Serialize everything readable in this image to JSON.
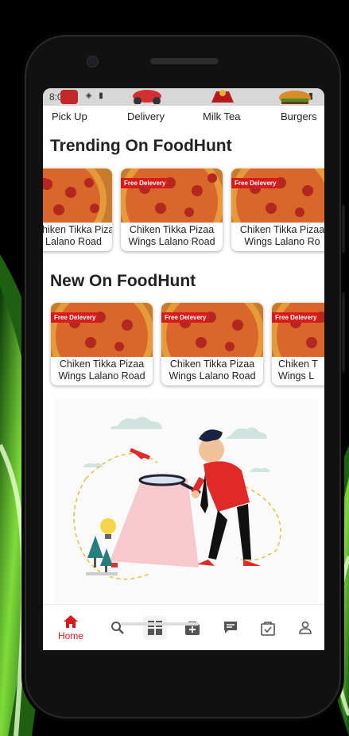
{
  "status_bar": {
    "time": "8:05"
  },
  "categories": [
    "Pick Up",
    "Delivery",
    "Milk Tea",
    "Burgers"
  ],
  "trending": {
    "title": "Trending On FoodHunt",
    "cards": [
      {
        "badge": "",
        "line1": "Chiken Tikka Pizaa",
        "line2": "Lalano Road"
      },
      {
        "badge": "Free Delevery",
        "line1": "Chiken Tikka Pizaa",
        "line2": "Wings Lalano Road"
      },
      {
        "badge": "Free Delevery",
        "line1": "Chiken Tikka Pizaa",
        "line2": "Wings Lalano Ro"
      }
    ]
  },
  "new": {
    "title": "New On FoodHunt",
    "cards": [
      {
        "badge": "Free Delevery",
        "line1": "Chiken Tikka Pizaa",
        "line2": "Wings  Lalano Road"
      },
      {
        "badge": "Free Delevery",
        "line1": "Chiken Tikka Pizaa",
        "line2": "Wings  Lalano Road"
      },
      {
        "badge": "Free Delevery",
        "line1": "Chiken T",
        "line2": "Wings  L"
      }
    ]
  },
  "bottom_nav": {
    "active_color": "#d71a1a",
    "items": [
      {
        "icon": "home-icon",
        "label": "Home"
      },
      {
        "icon": "search-icon"
      },
      {
        "icon": "grid-icon"
      },
      {
        "icon": "bag-add-icon"
      },
      {
        "icon": "chat-icon"
      },
      {
        "icon": "shopping-bag-check-icon"
      },
      {
        "icon": "person-icon"
      }
    ]
  }
}
